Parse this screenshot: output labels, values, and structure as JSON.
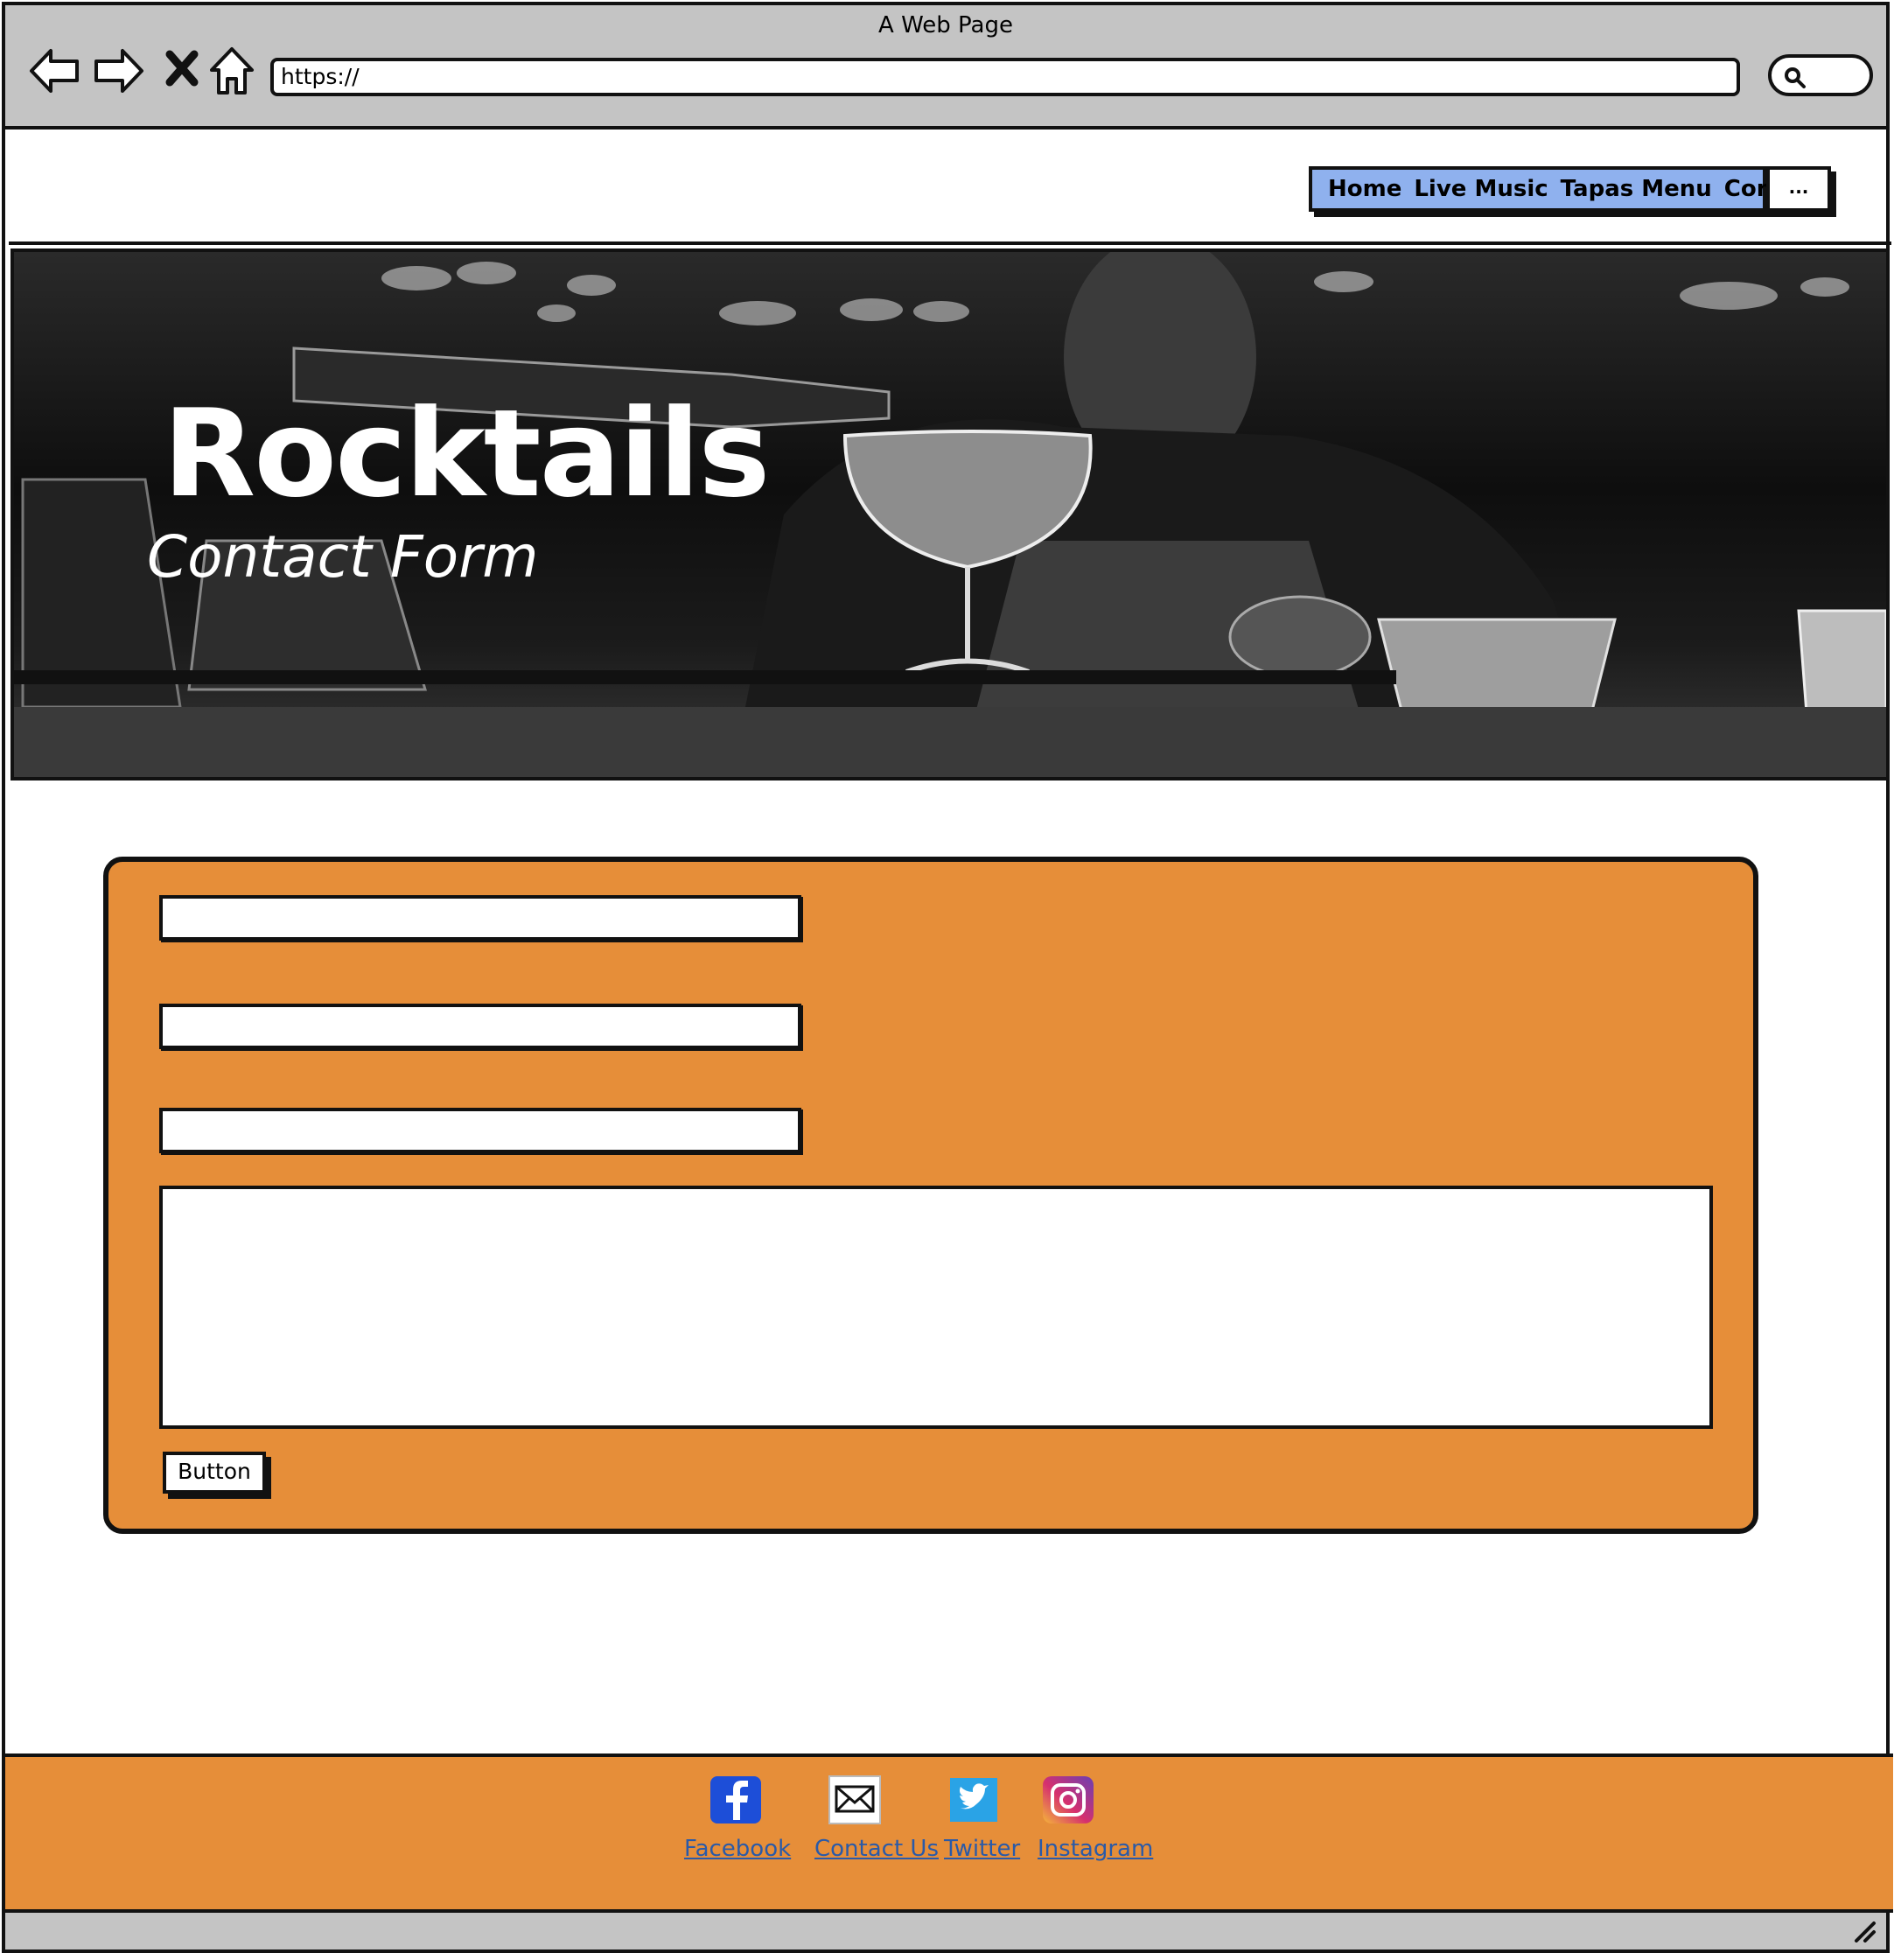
{
  "browser": {
    "title": "A Web Page",
    "url": "https://",
    "icons": [
      "back-arrow-icon",
      "forward-arrow-icon",
      "close-icon",
      "home-icon",
      "search-icon"
    ]
  },
  "nav": {
    "items": [
      "Home",
      "Live Music",
      "Tapas Menu",
      "Contact"
    ],
    "more_label": "...",
    "accent": "#8fb1ee"
  },
  "hero": {
    "title": "Rocktails",
    "subtitle": "Contact Form"
  },
  "form": {
    "background": "#e68e39",
    "button_label": "Button"
  },
  "footer": {
    "background": "#e68e39",
    "links": [
      {
        "label": "Facebook",
        "icon": "facebook-icon"
      },
      {
        "label": "Contact Us",
        "icon": "mail-icon"
      },
      {
        "label": "Twitter",
        "icon": "twitter-icon"
      },
      {
        "label": "Instagram",
        "icon": "instagram-icon"
      }
    ]
  }
}
